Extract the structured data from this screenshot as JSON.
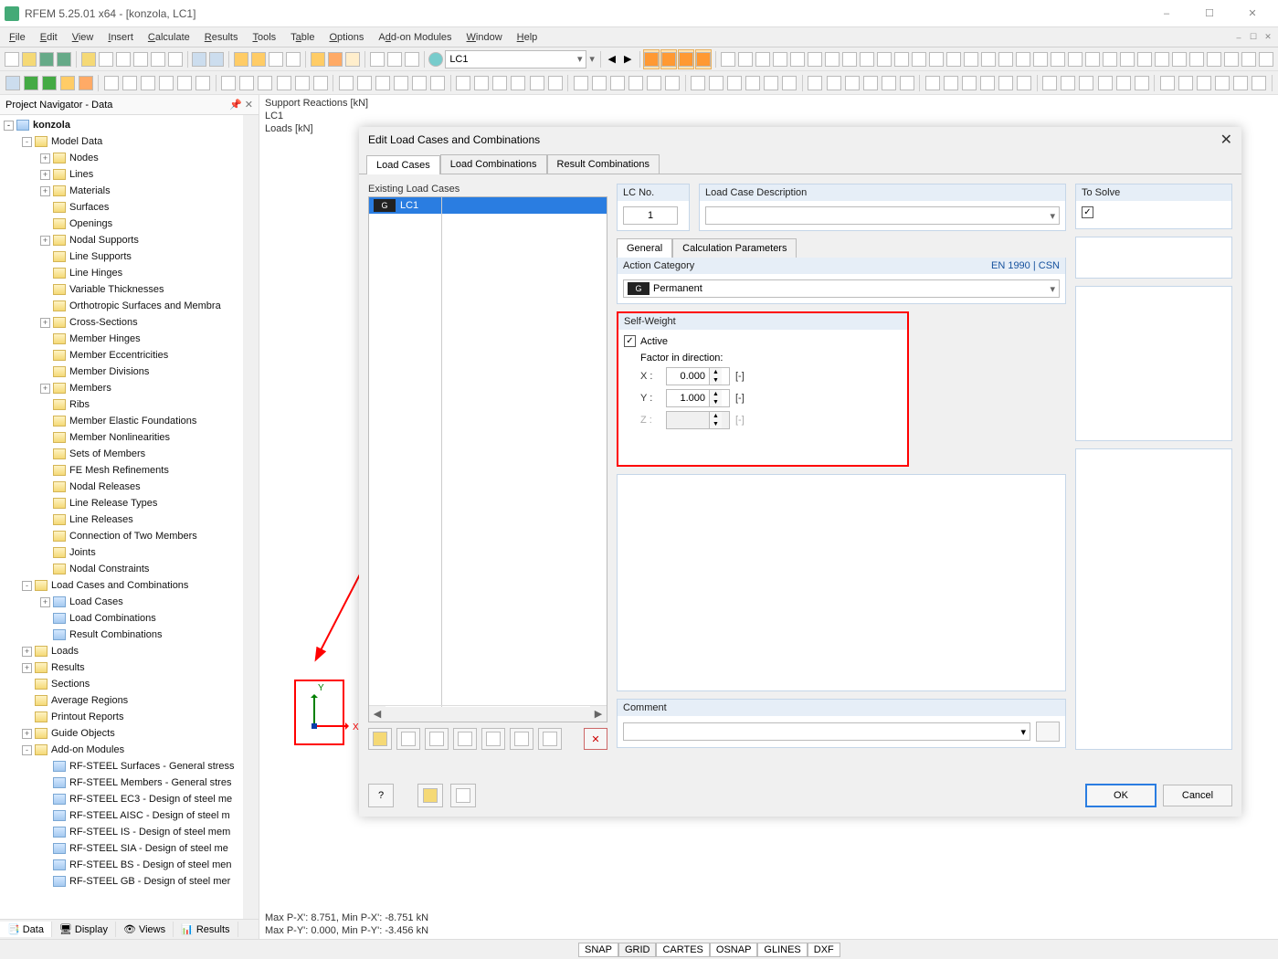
{
  "window": {
    "title": "RFEM 5.25.01 x64 - [konzola, LC1]"
  },
  "menu": [
    "File",
    "Edit",
    "View",
    "Insert",
    "Calculate",
    "Results",
    "Tools",
    "Table",
    "Options",
    "Add-on Modules",
    "Window",
    "Help"
  ],
  "toolbar": {
    "lc_selector": "LC1"
  },
  "navigator": {
    "title": "Project Navigator - Data",
    "root": "konzola",
    "model_data": "Model Data",
    "model_children": [
      "Nodes",
      "Lines",
      "Materials",
      "Surfaces",
      "Openings",
      "Nodal Supports",
      "Line Supports",
      "Line Hinges",
      "Variable Thicknesses",
      "Orthotropic Surfaces and Membra",
      "Cross-Sections",
      "Member Hinges",
      "Member Eccentricities",
      "Member Divisions",
      "Members",
      "Ribs",
      "Member Elastic Foundations",
      "Member Nonlinearities",
      "Sets of Members",
      "FE Mesh Refinements",
      "Nodal Releases",
      "Line Release Types",
      "Line Releases",
      "Connection of Two Members",
      "Joints",
      "Nodal Constraints"
    ],
    "lcc": "Load Cases and Combinations",
    "lcc_children": [
      "Load Cases",
      "Load Combinations",
      "Result Combinations"
    ],
    "loads": "Loads",
    "results": "Results",
    "sections": "Sections",
    "avg_regions": "Average Regions",
    "printout": "Printout Reports",
    "guide": "Guide Objects",
    "addons": "Add-on Modules",
    "addon_children": [
      "RF-STEEL Surfaces - General stress",
      "RF-STEEL Members - General stres",
      "RF-STEEL EC3 - Design of steel me",
      "RF-STEEL AISC - Design of steel m",
      "RF-STEEL IS - Design of steel mem",
      "RF-STEEL SIA - Design of steel me",
      "RF-STEEL BS - Design of steel men",
      "RF-STEEL GB - Design of steel mer"
    ],
    "tabs": [
      "Data",
      "Display",
      "Views",
      "Results"
    ]
  },
  "canvas": {
    "label1": "Support Reactions [kN]",
    "label2": "LC1",
    "label3": "Loads [kN]",
    "status1": "Max P-X': 8.751, Min P-X': -8.751 kN",
    "status2": "Max P-Y': 0.000, Min P-Y': -3.456 kN",
    "y": "Y",
    "x": "X"
  },
  "dialog": {
    "title": "Edit Load Cases and Combinations",
    "tabs": [
      "Load Cases",
      "Load Combinations",
      "Result Combinations"
    ],
    "existing_label": "Existing Load Cases",
    "lc_rows": [
      {
        "badge": "G",
        "name": "LC1"
      }
    ],
    "lcno_label": "LC No.",
    "lcno_value": "1",
    "desc_label": "Load Case Description",
    "desc_value": "",
    "to_solve_label": "To Solve",
    "inner_tabs": [
      "General",
      "Calculation Parameters"
    ],
    "action_category_label": "Action Category",
    "action_std": "EN 1990 | CSN",
    "action_badge": "G",
    "action_value": "Permanent",
    "selfweight_label": "Self-Weight",
    "active_label": "Active",
    "factor_label": "Factor in direction:",
    "factor_x_label": "X :",
    "factor_x_value": "0.000",
    "factor_y_label": "Y :",
    "factor_y_value": "1.000",
    "factor_z_label": "Z :",
    "factor_z_value": "",
    "unit": "[-]",
    "comment_label": "Comment",
    "ok": "OK",
    "cancel": "Cancel"
  },
  "statusbar": {
    "items": [
      "SNAP",
      "GRID",
      "CARTES",
      "OSNAP",
      "GLINES",
      "DXF"
    ]
  }
}
